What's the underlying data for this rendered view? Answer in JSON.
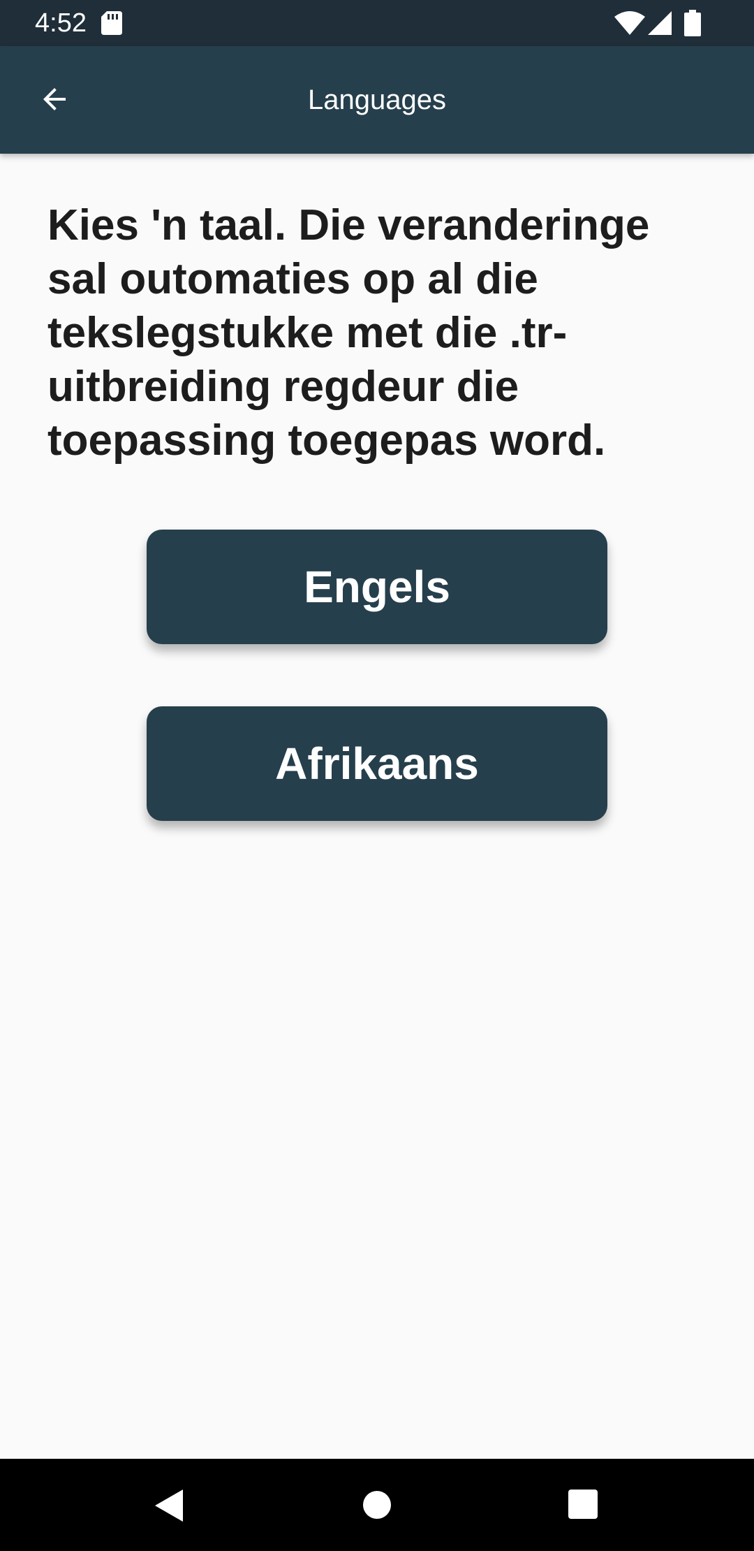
{
  "status_bar": {
    "time": "4:52",
    "icons": [
      "sd-card-icon",
      "wifi-icon",
      "signal-icon",
      "battery-icon"
    ]
  },
  "app_bar": {
    "title": "Languages",
    "back_icon": "arrow-left-icon"
  },
  "main": {
    "description": "Kies 'n taal. Die veranderinge sal outomaties op al die tekslegstukke met die .tr-uitbreiding regdeur die toepassing toegepas word.",
    "buttons": [
      {
        "label": "Engels"
      },
      {
        "label": "Afrikaans"
      }
    ]
  },
  "nav_bar": {
    "icons": [
      "back-triangle-icon",
      "home-circle-icon",
      "recents-square-icon"
    ]
  },
  "colors": {
    "status_bar": "#1f2e38",
    "app_bar": "#263f4c",
    "button": "#263f4c",
    "background": "#fafafa",
    "text": "#1d1d1d"
  }
}
